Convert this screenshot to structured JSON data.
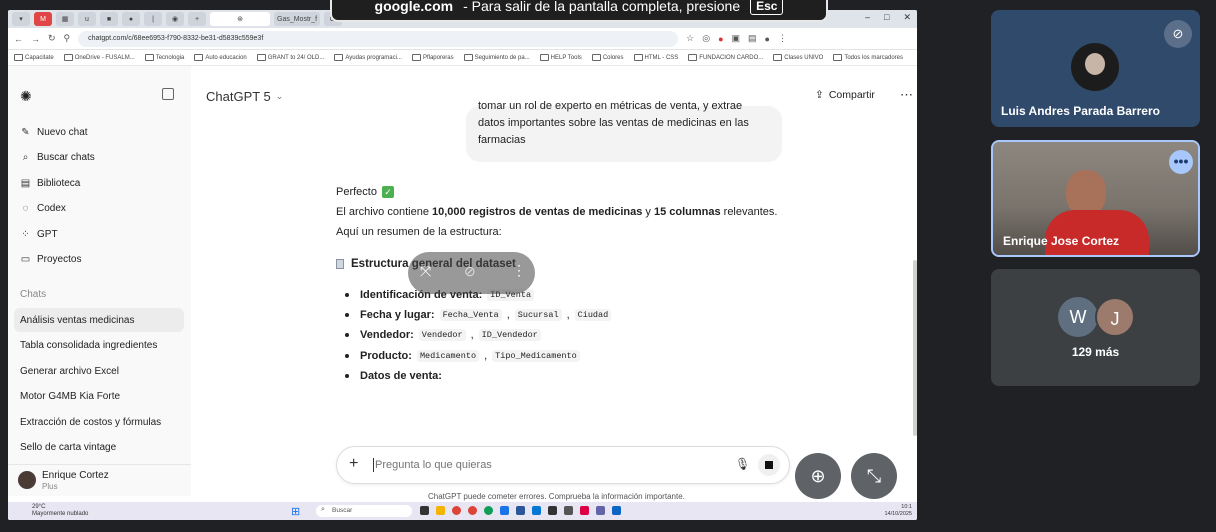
{
  "browser": {
    "tabs": [
      "Gas_Mostr_f",
      "Gi"
    ],
    "url": "chatgpt.com/c/68ee6953-f790-8332-be31-d5839c559e3f",
    "bookmarks": [
      "Capacitate",
      "OneDrive - FUSALM...",
      "Tecnologia",
      "Auto educacion",
      "GRANT to 24/ OLD...",
      "Ayudas programaci...",
      "Pflaporeras",
      "Seguimiento de pa...",
      "HELP Tools",
      "Colores",
      "HTML - CSS",
      "FUNDACION CARDO...",
      "Clases UNIVO",
      "Todos los marcadores"
    ]
  },
  "fullscreen_toast": {
    "site": "google.com",
    "message": "- Para salir de la pantalla completa, presione",
    "key": "Esc"
  },
  "sidebar": {
    "nav": [
      {
        "label": "Nuevo chat",
        "icon": "edit-icon"
      },
      {
        "label": "Buscar chats",
        "icon": "search-icon"
      },
      {
        "label": "Biblioteca",
        "icon": "library-icon"
      },
      {
        "label": "Codex",
        "icon": "codex-icon"
      },
      {
        "label": "GPT",
        "icon": "grid-icon"
      },
      {
        "label": "Proyectos",
        "icon": "folder-icon"
      }
    ],
    "section_title": "Chats",
    "chats": [
      "Análisis ventas medicinas",
      "Tabla consolidada ingredientes",
      "Generar archivo Excel",
      "Motor G4MB Kia Forte",
      "Extracción de costos y fórmulas",
      "Sello de carta vintage"
    ],
    "user": {
      "name": "Enrique Cortez",
      "plan": "Plus"
    }
  },
  "header": {
    "model": "ChatGPT 5",
    "share": "Compartir"
  },
  "conversation": {
    "user_bubble_lines": [
      "tomar un rol de experto en métricas de venta, y extrae",
      "datos importantes sobre las ventas de medicinas en las",
      "farmacias"
    ],
    "answer_intro": "Perfecto",
    "answer_line1_a": "El archivo contiene ",
    "answer_line1_b": "10,000 registros de ventas de medicinas",
    "answer_line1_c": " y ",
    "answer_line1_d": "15 columnas",
    "answer_line1_e": " relevantes.",
    "answer_line2": "Aquí un resumen de la estructura:",
    "structure_title": "Estructura general del dataset",
    "bullets": [
      {
        "label": "Identificación de venta:",
        "codes": [
          "ID_Venta"
        ]
      },
      {
        "label": "Fecha y lugar:",
        "codes": [
          "Fecha_Venta",
          "Sucursal",
          "Ciudad"
        ]
      },
      {
        "label": "Vendedor:",
        "codes": [
          "Vendedor",
          "ID_Vendedor"
        ]
      },
      {
        "label": "Producto:",
        "codes": [
          "Medicamento",
          "Tipo_Medicamento"
        ]
      },
      {
        "label": "Datos de venta:",
        "codes": []
      }
    ]
  },
  "composer": {
    "placeholder": "Pregunta lo que quieras",
    "disclaimer": "ChatGPT puede cometer errores. Comprueba la información importante."
  },
  "taskbar": {
    "weather": "29°C",
    "weather_desc": "Mayormente nublado",
    "search": "Buscar",
    "time": "10:1",
    "date": "14/10/2025"
  },
  "participants": [
    {
      "name": "Luis Andres Parada Barrero"
    },
    {
      "name": "Enrique Jose Cortez"
    },
    {
      "more_label": "129 más",
      "avatars": [
        "W",
        "J"
      ]
    }
  ],
  "colors": {
    "avatar_w": "#5f6f80",
    "avatar_j": "#9c7b6c",
    "tile_active_border": "#a8c7fa"
  }
}
